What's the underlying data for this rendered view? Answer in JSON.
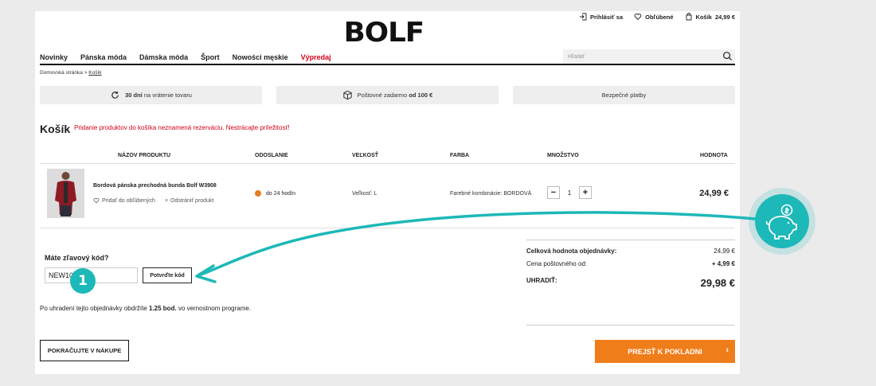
{
  "util": {
    "login": "Prihlásiť sa",
    "favorites": "Obľúbené",
    "cart": "Košík",
    "cart_total": "24,99 €"
  },
  "logo": "BOLF",
  "nav": [
    "Novinky",
    "Pánska móda",
    "Dámska móda",
    "Šport",
    "Nowości męskie",
    "Výpredaj"
  ],
  "search": {
    "placeholder": "Hľadať"
  },
  "breadcrumb": {
    "home": "Domovská stránka",
    "sep": ">",
    "current": "Košík"
  },
  "info": {
    "returns_bold": "30 dní",
    "returns_text": "na vrátenie tovaru",
    "shipping_text": "Poštovné zadarmo",
    "shipping_bold": "od 100 €",
    "payments": "Bezpečné platby"
  },
  "cart": {
    "title": "Košík",
    "notice": "Pridanie produktov do košíka neznamená rezerváciu. Nestrácajte príležitosť!",
    "headers": {
      "product": "NÁZOV PRODUKTU",
      "shipping": "ODOSLANIE",
      "size": "VEĽKOSŤ",
      "color": "FARBA",
      "qty": "MNOŽSTVO",
      "value": "HODNOTA"
    },
    "item": {
      "name": "Bordová pánska prechodná bunda Bolf W3908",
      "add_fav": "Pridať do obľúbených",
      "remove": "Odstrániť produkt",
      "shipping": "do 24 hodín",
      "size": "Veľkosť: L",
      "color": "Farebné kombinácie: BORDOVÁ",
      "qty": "1",
      "price": "24,99 €"
    }
  },
  "coupon": {
    "label": "Máte zľavový kód?",
    "value": "NEW10",
    "button": "Potvrďte kód"
  },
  "loyalty": {
    "pre": "Po uhradení tejto objednávky obdržíte",
    "bold": "1.25 bod.",
    "post": "vo vernostnom programe."
  },
  "summary": {
    "order_label": "Celková hodnota objednávky:",
    "order_value": "24,99 €",
    "ship_label": "Cena poštovného od:",
    "ship_value": "+ 4,99 €",
    "total_label": "UHRADIŤ:",
    "total_value": "29,98 €"
  },
  "buttons": {
    "continue": "POKRAČUJTE V NÁKUPE",
    "checkout": "PREJSŤ K POKLADNI",
    "checkout_arrow": "›"
  },
  "annotation": {
    "step": "1"
  },
  "colors": {
    "accent": "#ef7d1a",
    "sale": "#d0021b",
    "annotation": "#1db8b8"
  }
}
